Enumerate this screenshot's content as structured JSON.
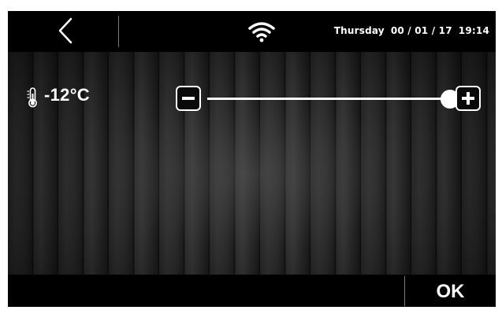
{
  "header": {
    "back_icon": "chevron-left-icon",
    "wifi_icon": "wifi-icon",
    "day": "Thursday",
    "date": "00 / 01 / 17",
    "time": "19:14"
  },
  "temperature": {
    "icon": "thermometer-icon",
    "value": "-12°C",
    "slider_level": 1.0,
    "minus_icon": "minus-icon",
    "plus_icon": "plus-icon"
  },
  "footer": {
    "ok_label": "OK"
  },
  "colors": {
    "bar_background": "#000000",
    "foreground": "#ffffff",
    "divider": "#7a7a7a"
  }
}
